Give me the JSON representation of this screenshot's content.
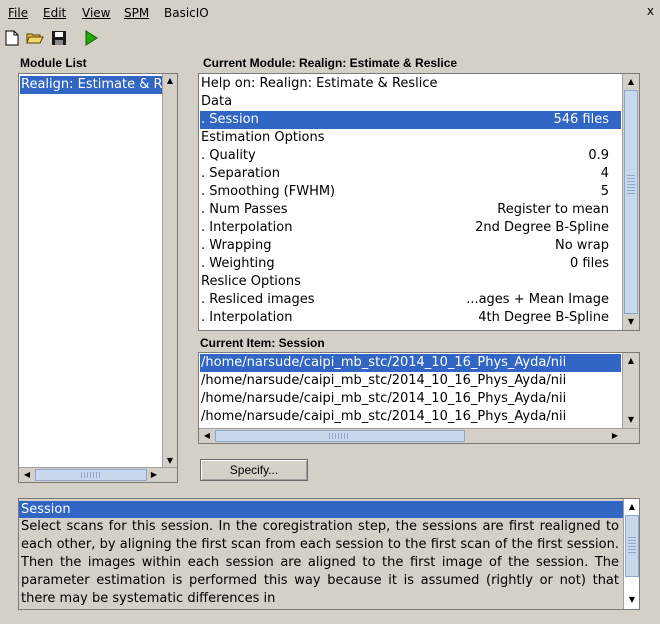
{
  "menu": {
    "items": [
      {
        "label": "File"
      },
      {
        "label": "Edit"
      },
      {
        "label": "View"
      },
      {
        "label": "SPM"
      },
      {
        "label": "BasicIO"
      }
    ],
    "close_glyph": "x"
  },
  "toolbar": {
    "icons": [
      "new-file-icon",
      "open-folder-icon",
      "save-icon",
      "run-icon"
    ],
    "run_color": "#22aa00"
  },
  "module_list": {
    "title": "Module List",
    "items": [
      {
        "label": "Realign: Estimate & Reslice"
      }
    ]
  },
  "current_module": {
    "title": "Current Module: Realign: Estimate & Reslice",
    "rows": [
      {
        "key": "Help on: Realign: Estimate & Reslice",
        "value": ""
      },
      {
        "key": "Data",
        "value": ""
      },
      {
        "key": ". Session",
        "value": "546 files",
        "selected": true
      },
      {
        "key": "Estimation Options",
        "value": ""
      },
      {
        "key": ". Quality",
        "value": "0.9"
      },
      {
        "key": ". Separation",
        "value": "4"
      },
      {
        "key": ". Smoothing (FWHM)",
        "value": "5"
      },
      {
        "key": ". Num Passes",
        "value": "Register to mean"
      },
      {
        "key": ". Interpolation",
        "value": "2nd Degree B-Spline"
      },
      {
        "key": ". Wrapping",
        "value": "No wrap"
      },
      {
        "key": ". Weighting",
        "value": "0 files"
      },
      {
        "key": "Reslice Options",
        "value": ""
      },
      {
        "key": ". Resliced images",
        "value": "...ages + Mean Image"
      },
      {
        "key": ". Interpolation",
        "value": "4th Degree B-Spline"
      }
    ]
  },
  "current_item": {
    "title": "Current Item: Session",
    "files": [
      "/home/narsude/caipi_mb_stc/2014_10_16_Phys_Ayda/nii",
      "/home/narsude/caipi_mb_stc/2014_10_16_Phys_Ayda/nii",
      "/home/narsude/caipi_mb_stc/2014_10_16_Phys_Ayda/nii",
      "/home/narsude/caipi_mb_stc/2014_10_16_Phys_Ayda/nii"
    ]
  },
  "specify_button": "Specify...",
  "help": {
    "title": "Session",
    "text": "Select scans for this session. In the coregistration step, the sessions are first realigned to each other, by aligning the first scan from each session to the first scan of the first session. Then the images within each session are aligned to the first image of the session. The parameter estimation is performed this way because it is assumed (rightly or not) that there may be systematic differences in"
  },
  "colors": {
    "selection": "#3166c4",
    "window_bg": "#d4d0c8",
    "scroll_thumb": "#c8d9ee"
  }
}
